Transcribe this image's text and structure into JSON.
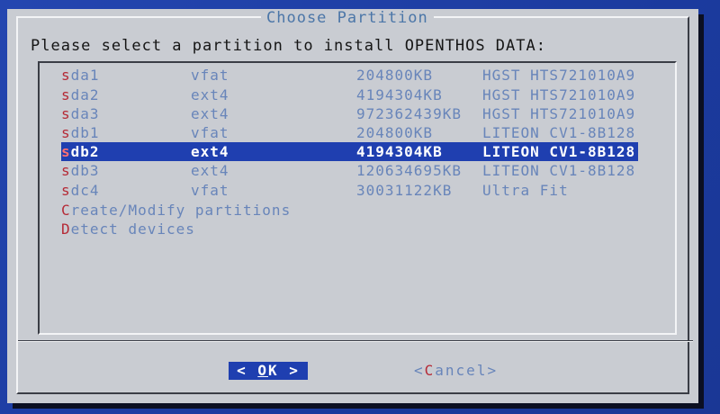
{
  "dialog": {
    "title": "Choose Partition",
    "prompt": "Please select a partition to install OPENTHOS DATA:"
  },
  "partitions": [
    {
      "hotkey": "s",
      "rest": "da1",
      "fs": "vfat",
      "size": "204800KB",
      "model": "HGST HTS721010A9"
    },
    {
      "hotkey": "s",
      "rest": "da2",
      "fs": "ext4",
      "size": "4194304KB",
      "model": "HGST HTS721010A9"
    },
    {
      "hotkey": "s",
      "rest": "da3",
      "fs": "ext4",
      "size": "972362439KB",
      "model": "HGST HTS721010A9"
    },
    {
      "hotkey": "s",
      "rest": "db1",
      "fs": "vfat",
      "size": "204800KB",
      "model": "LITEON CV1-8B128"
    },
    {
      "hotkey": "s",
      "rest": "db2",
      "fs": "ext4",
      "size": "4194304KB",
      "model": "LITEON CV1-8B128"
    },
    {
      "hotkey": "s",
      "rest": "db3",
      "fs": "ext4",
      "size": "120634695KB",
      "model": "LITEON CV1-8B128"
    },
    {
      "hotkey": "s",
      "rest": "dc4",
      "fs": "vfat",
      "size": "30031122KB",
      "model": "Ultra Fit"
    }
  ],
  "selected_index": 4,
  "actions": [
    {
      "hotkey": "C",
      "rest": "reate/Modify partitions"
    },
    {
      "hotkey": "D",
      "rest": "etect devices"
    }
  ],
  "buttons": {
    "ok": {
      "left": "<",
      "hotkey": "O",
      "rest": "K",
      "right": ">"
    },
    "cancel": {
      "left": "<",
      "hotkey": "C",
      "rest": "ancel",
      "right": ">"
    }
  },
  "colors": {
    "background": "#1d3fa8",
    "dialog": "#c9ccd2",
    "selection": "#1f3fb0",
    "hotkey": "#b52a36",
    "item_text": "#6885ba",
    "title_text": "#4b76a8"
  }
}
